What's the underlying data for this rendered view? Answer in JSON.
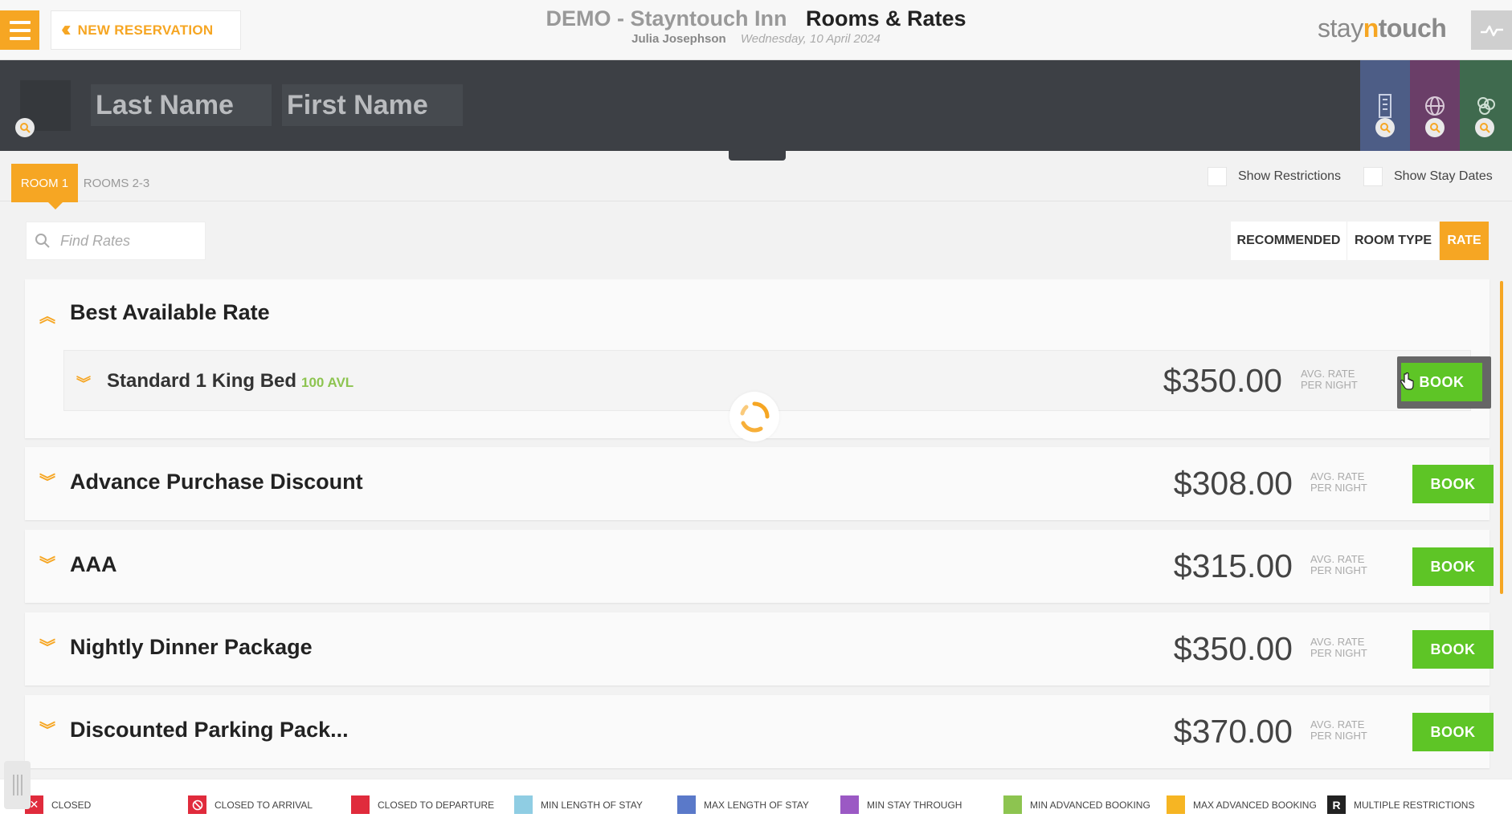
{
  "header": {
    "new_reservation_label": "NEW RESERVATION",
    "hotel_name": "DEMO - Stayntouch Inn",
    "page_title": "Rooms & Rates",
    "user_name": "Julia Josephson",
    "date": "Wednesday, 10 April 2024",
    "logo": {
      "part1": "stay",
      "part2": "n",
      "part3": "touch"
    }
  },
  "search": {
    "last_name_placeholder": "Last Name",
    "first_name_placeholder": "First Name"
  },
  "room_tabs": {
    "active": "ROOM 1",
    "inactive": "ROOMS 2-3"
  },
  "toggles": {
    "show_restrictions": "Show Restrictions",
    "show_stay_dates": "Show Stay Dates"
  },
  "find_rates_placeholder": "Find Rates",
  "sort": {
    "recommended": "RECOMMENDED",
    "room_type": "ROOM TYPE",
    "rate": "RATE"
  },
  "avg_line1": "AVG. RATE",
  "avg_line2": "PER NIGHT",
  "book_label": "BOOK",
  "rates": [
    {
      "name": "Best Available Rate",
      "expanded": true,
      "room": {
        "name": "Standard 1 King Bed",
        "availability": "100 AVL",
        "price": "$350.00"
      }
    },
    {
      "name": "Advance Purchase Discount",
      "price": "$308.00"
    },
    {
      "name": "AAA",
      "price": "$315.00"
    },
    {
      "name": "Nightly Dinner Package",
      "price": "$350.00"
    },
    {
      "name": "Discounted Parking Pack...",
      "price": "$370.00"
    }
  ],
  "legend": [
    {
      "label": "CLOSED",
      "color": "#e02b3c",
      "icon": "x"
    },
    {
      "label": "CLOSED TO ARRIVAL",
      "color": "#e02b3c",
      "icon": "no-entry"
    },
    {
      "label": "CLOSED TO DEPARTURE",
      "color": "#e02b3c",
      "icon": ""
    },
    {
      "label": "MIN LENGTH OF STAY",
      "color": "#8fcde3",
      "icon": ""
    },
    {
      "label": "MAX LENGTH OF STAY",
      "color": "#5a79c9",
      "icon": ""
    },
    {
      "label": "MIN STAY THROUGH",
      "color": "#9b59c4",
      "icon": ""
    },
    {
      "label": "MIN ADVANCED BOOKING",
      "color": "#8dc450",
      "icon": ""
    },
    {
      "label": "MAX ADVANCED BOOKING",
      "color": "#f6b523",
      "icon": ""
    },
    {
      "label": "MULTIPLE RESTRICTIONS",
      "color": "#222222",
      "icon": "R"
    }
  ],
  "colors": {
    "accent": "#f6a623",
    "book_green": "#5ec526",
    "dark_band": "#3d4045"
  }
}
